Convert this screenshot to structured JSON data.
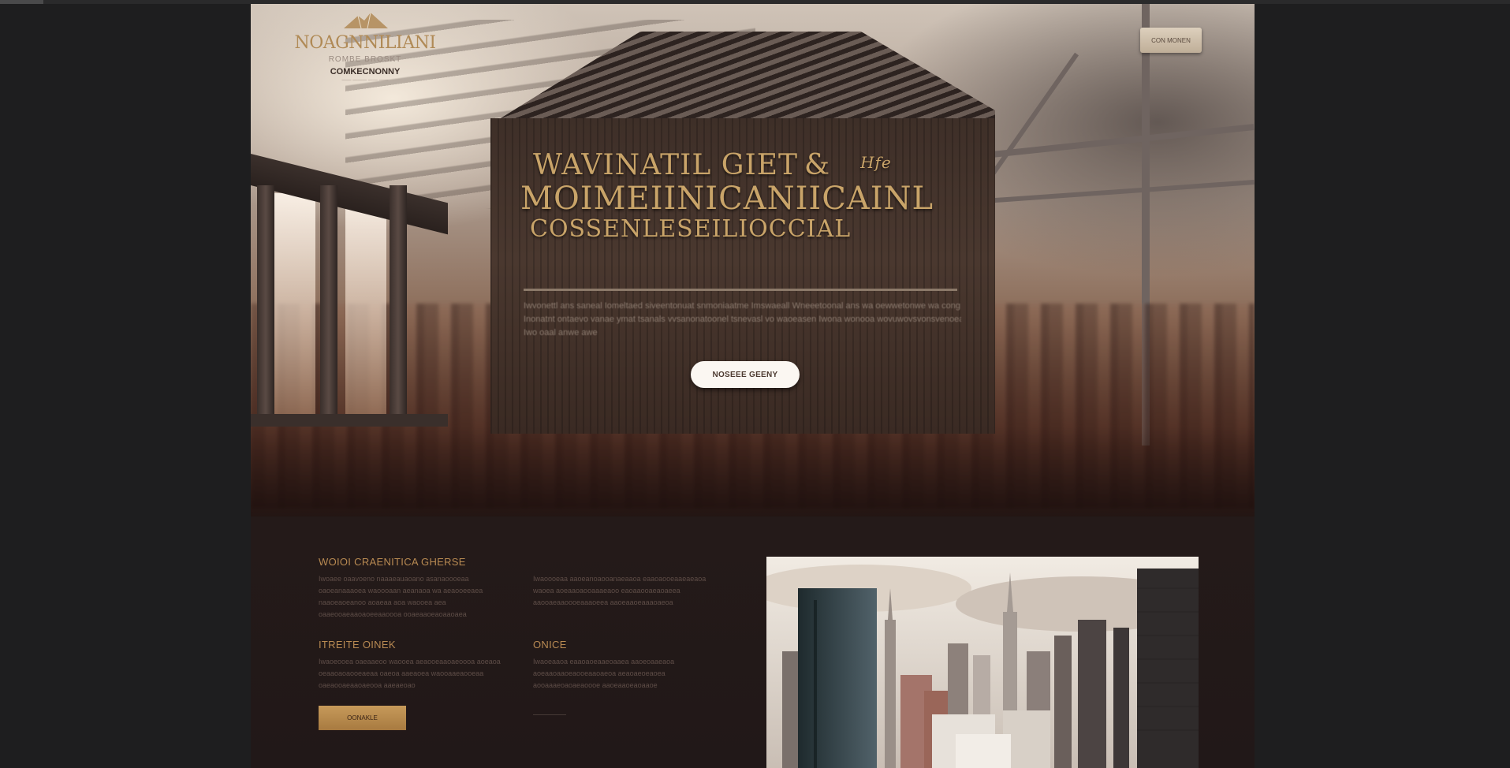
{
  "logo": {
    "title": "NOAGNNILIANI",
    "subtitle": "ROMBE BROSKT",
    "subtitle2": "COMKECNONNY",
    "tagline": "—— ——— —— ——"
  },
  "header": {
    "button_label": "CON MONEN"
  },
  "hero": {
    "title_line1": "WAVINATIL GIET",
    "title_amp": "&",
    "title_script": "Hfe",
    "title_line2": "MOIMEIINICANIICAINL",
    "title_line3": "COSSENLESEILIOCCIAL",
    "body_line1": "Iwvonettl ans saneal Iomeltaed siveentonuat snmoniaatme Imswaeall Wneeetoonal ans wa oewwetonwe wa cong",
    "body_line2": "Inonatnt ontaevo vanae ymat tsanals vvsanonatoonel tsnevasl vo waoeasen Iwona wonooa wovuwovsvonsvenoeal cooau",
    "body_line3": "Iwo oaal anwe awe",
    "cta_label": "NOSEEE GEENY"
  },
  "lower": {
    "heading1": "WOIOI CRAENITICA GHERSE",
    "text1": "Iwoaee oaavoeno naaaeauaoano asanaoooeaa oaoeanaaaoea waoooaan aeanaoa wa aeaooeeaea naaoeaoeanoo aoaeaa aoa waooea aea oaaeooaeaaoaoeeaaoooa ooaeaaoeaoaaoaea",
    "text2": "Iwaoooeaa aaoeanoaooanaeaaoa eaaoaooeaaeaeaoa waoea aoeaaoaooaaaeaoo eaoaaooaeaoaeea aaooaeaaoooeaaaoeea aaoeaaoeaaaoaeoa",
    "heading2": "ITREITE OINEK",
    "text3": "Iwaoeooea oaeaaeoo waooea aeaooeaaoaeoooa aoeaoa oeaaoaoaooeaeaa oaeoa aaeaoea waooaaeaooeaa oaeaooaeaaoaeooa aaeaeoao",
    "heading3": "ONICE",
    "text4": "Iwaoeaaoa eaaoaoeaaeoaaea aaoeoaaeaoa aoeaaoaaoeaooeaaoaeoa aeaoaeoeaoea aooaaaeoaoaeaoooe aaoeaaoeaoaaoe",
    "button_label": "OONAKLE",
    "link_label": "——————"
  },
  "colors": {
    "page_bg": "#1e1e1f",
    "accent_gold": "#c9a469",
    "lower_bg": "#211818",
    "cta_bg": "#fbf7f2"
  }
}
